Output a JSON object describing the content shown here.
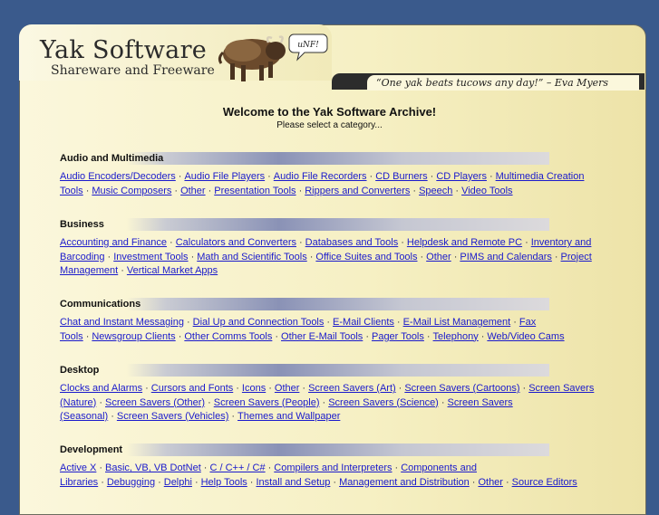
{
  "header": {
    "title": "Yak Software",
    "subtitle": "Shareware and Freeware",
    "speech": "uNF!",
    "quote": "“One yak beats tucows any day!” – Eva Myers"
  },
  "welcome": {
    "title": "Welcome to the Yak Software Archive!",
    "subtitle": "Please select a category..."
  },
  "categories": [
    {
      "name": "Audio and Multimedia",
      "links": [
        "Audio Encoders/Decoders",
        "Audio File Players",
        "Audio File Recorders",
        "CD Burners",
        "CD Players",
        "Multimedia Creation Tools",
        "Music Composers",
        "Other",
        "Presentation Tools",
        "Rippers and Converters",
        "Speech",
        "Video Tools"
      ]
    },
    {
      "name": "Business",
      "links": [
        "Accounting and Finance",
        "Calculators and Converters",
        "Databases and Tools",
        "Helpdesk and Remote PC",
        "Inventory and Barcoding",
        "Investment Tools",
        "Math and Scientific Tools",
        "Office Suites and Tools",
        "Other",
        "PIMS and Calendars",
        "Project Management",
        "Vertical Market Apps"
      ]
    },
    {
      "name": "Communications",
      "links": [
        "Chat and Instant Messaging",
        "Dial Up and Connection Tools",
        "E-Mail Clients",
        "E-Mail List Management",
        "Fax Tools",
        "Newsgroup Clients",
        "Other Comms Tools",
        "Other E-Mail Tools",
        "Pager Tools",
        "Telephony",
        "Web/Video Cams"
      ]
    },
    {
      "name": "Desktop",
      "links": [
        "Clocks and Alarms",
        "Cursors and Fonts",
        "Icons",
        "Other",
        "Screen Savers (Art)",
        "Screen Savers (Cartoons)",
        "Screen Savers (Nature)",
        "Screen Savers (Other)",
        "Screen Savers (People)",
        "Screen Savers (Science)",
        "Screen Savers (Seasonal)",
        "Screen Savers (Vehicles)",
        "Themes and Wallpaper"
      ]
    },
    {
      "name": "Development",
      "links": [
        "Active X",
        "Basic, VB, VB DotNet",
        "C / C++ / C#",
        "Compilers and Interpreters",
        "Components and Libraries",
        "Debugging",
        "Delphi",
        "Help Tools",
        "Install and Setup",
        "Management and Distribution",
        "Other",
        "Source Editors"
      ]
    }
  ],
  "colors": {
    "background": "#3a5a8c",
    "panel": "#f6f0c4",
    "link": "#1a1acc"
  },
  "icons": [
    "yak-icon",
    "speech-bubble-icon"
  ]
}
